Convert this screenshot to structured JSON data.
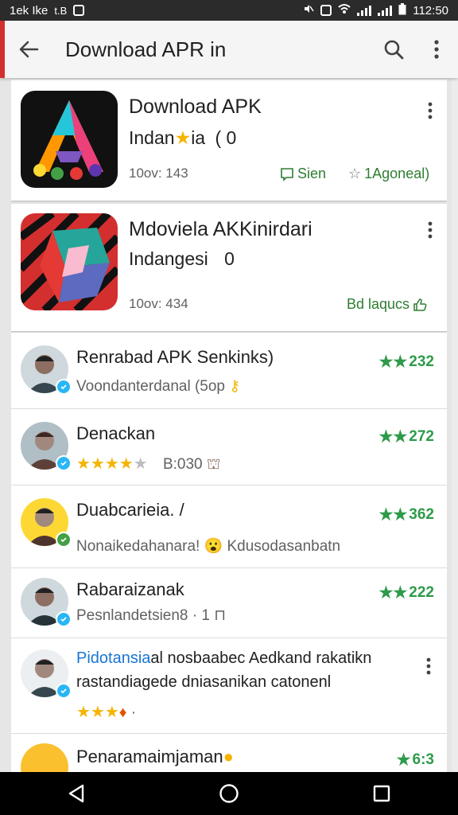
{
  "status_bar": {
    "left_text": "1ek Ike",
    "left_glyph": "t.B",
    "time": "112:50"
  },
  "app_bar": {
    "title": "Download APR in",
    "back_icon": "arrow-left-icon",
    "search_icon": "search-icon",
    "menu_icon": "more-vert-icon"
  },
  "cards": [
    {
      "title": "Download APK",
      "subtitle_before": "Indan",
      "subtitle_after": "ia",
      "subtitle_tail": "( 0",
      "meta": "10ov: 143",
      "action_1": "Sien",
      "action_2": "1Agoneal)"
    },
    {
      "title": "Mdoviela AKKinirdari",
      "subtitle": "Indangesi",
      "subtitle_tail": "0",
      "meta": "10ov: 434",
      "action": "Bd laqucs"
    }
  ],
  "list": [
    {
      "title": "Renrabad APK Senkinks)",
      "subtitle": "Voondanterdanal (5op",
      "score": "232"
    },
    {
      "title": "Denackan",
      "stars": "★★★★",
      "star_empty": "★",
      "meta": "B:030",
      "score": "272"
    },
    {
      "title": "Duabcarieia. /",
      "subtitle": "Nonaikedahanara! 😮 Kdusodasanbatn",
      "score": "362"
    },
    {
      "title": "Rabaraizanak",
      "subtitle": "Pesnlandetsien8 · 1",
      "score": "222"
    },
    {
      "title_highlight": "Pidotansia",
      "title_rest": "al nosbaabec Aedkand rakatikn",
      "line2": "rastandiagede dniasanikan catonenl",
      "stars": "★★★",
      "dot": "·"
    },
    {
      "title": "Penaramaimjaman",
      "score": "6:3"
    }
  ],
  "colors": {
    "accent_red": "#d32f2f",
    "green": "#2e9b4a",
    "star_yellow": "#f5b400",
    "link_blue": "#1976d2"
  }
}
